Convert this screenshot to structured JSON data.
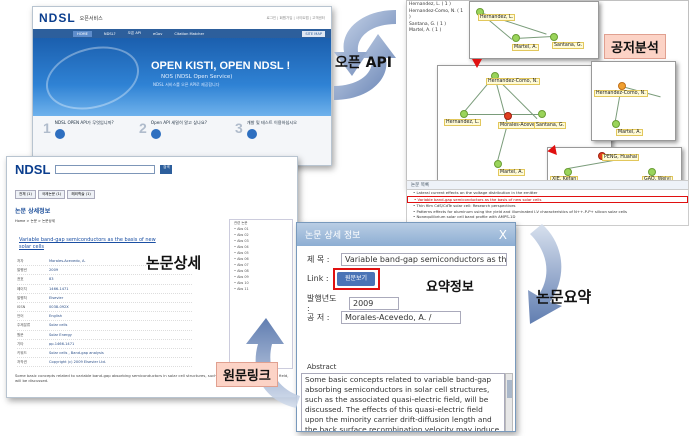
{
  "callouts": {
    "open_api": "오픈 API",
    "coauthor_analysis": "공저분석",
    "paper_detail": "논문상세",
    "paper_summary": "논문요약",
    "summary_info": "요약정보",
    "original_link": "원문링크"
  },
  "shot1": {
    "logo": "NDSL",
    "service": "오픈서비스",
    "toplinks": "로그인 | 회원가입 | 사이트맵 | 고객센터",
    "nav": [
      "HOME",
      "NDSL?",
      "오픈 API",
      "eGov",
      "Citation Matcher"
    ],
    "nav_sitemap": "SITE MAP",
    "hero_title": "OPEN KISTI, OPEN NDSL !",
    "hero_sub": "NOS (NDSL Open Service)",
    "hero_desc": "NDSL 서비스를 오픈 API로 제공합니다",
    "cards": [
      {
        "num": "1",
        "text": "NDSL OPEN API가 무엇입니까?"
      },
      {
        "num": "2",
        "text": "Open API 세밀히 알고 싶나요?"
      },
      {
        "num": "3",
        "text": "개발 및 테스트 이용하십시오"
      }
    ]
  },
  "shot2": {
    "authors": [
      "Hernandez, L. ( 1 )",
      "Hernandez-Como, N. ( 1 )",
      "Santana, G. ( 1 )",
      "Martel, A. ( 1 )"
    ],
    "nodes": {
      "hernandez": "Hernandez, L.",
      "martel": "Martel, A.",
      "santana": "Santana, G.",
      "hcomo": "Hernandez-Como, N.",
      "morales": "Morales-Acevedo",
      "pfeng": "PENG, Huahai",
      "xie": "XIE, Kefan",
      "gao": "GAO, Weiyi"
    },
    "footer": "논문 목록"
  },
  "midpanel": {
    "header": "논문 목록",
    "lines": [
      "• Lateral current effects on the voltage distribution in the emitter",
      "• Variable band-gap semiconductors as the basis of new solar cells",
      "• Thin film CdS/CdTe solar cell: Research perspectives",
      "• Patterns effects for aluminum using the yield and illuminated I-V characteristics of N++-P-P+ silicon solar cells",
      "• Nonequilibrium solar cell band profile with AMPS-1D"
    ]
  },
  "shot3": {
    "logo": "NDSL",
    "search_btn": "검색",
    "tabs": [
      "전체 (1)",
      "국제논문 (1)",
      "해외학술 (1)"
    ],
    "page_title": "논문 상세정보",
    "crumb": "Home > 논문 > 논문상세",
    "title": "Variable band-gap semiconductors as the basis of new solar cells",
    "rows": [
      {
        "k": "저자",
        "v": "Morales-Acevedo, A."
      },
      {
        "k": "발행년",
        "v": "2009"
      },
      {
        "k": "권호",
        "v": "83"
      },
      {
        "k": "페이지",
        "v": "1466-1471"
      },
      {
        "k": "발행처",
        "v": "Elsevier"
      },
      {
        "k": "ISSN",
        "v": "0038-092X"
      },
      {
        "k": "언어",
        "v": "English"
      },
      {
        "k": "주제분류",
        "v": "Solar cells"
      },
      {
        "k": "원문",
        "v": "Solar Energy"
      },
      {
        "k": "기타",
        "v": "pp.1466-1471"
      },
      {
        "k": "키워드",
        "v": "Solar cells , Band-gap analysis"
      },
      {
        "k": "저작권",
        "v": "Copyright (c) 2009 Elsevier Ltd."
      }
    ],
    "side": [
      "관련 논문",
      "• Abs 01",
      "• Abs 02",
      "• Abs 03",
      "• Abs 04",
      "• Abs 05",
      "• Abs 06",
      "• Abs 07",
      "• Abs 08",
      "• Abs 09",
      "• Abs 10",
      "• Abs 11"
    ],
    "abstract": "Some basic concepts related to variable band-gap absorbing semiconductors in solar cell structures, such as the associated quasi-electric field, will be discussed."
  },
  "shot4": {
    "title": "논문 상세 정보",
    "close": "X",
    "label_title": "제 목 :",
    "value_title": "Variable band-gap semiconductors as the basis of",
    "label_link": "Link :",
    "link_btn": "원문보기",
    "label_year": "발행년도 :",
    "value_year": "2009",
    "label_author": "공 저 :",
    "value_author": "Morales-Acevedo, A. /",
    "abstract_label": "Abstract",
    "abstract": "Some basic concepts related to variable band-gap absorbing semiconductors in solar cell structures, such as the associated quasi-electric field, will be discussed. The effects of this quasi-electric field upon the minority carrier drift-diffusion length and the back surface recombination velocity may induce a larger generated carrier collection at the junction with the corresponding"
  },
  "colors": {
    "accent_blue": "#2d5f9c",
    "callout_bg": "#fcd3c6",
    "highlight_red": "#e01010",
    "arrow_blue": "#4f6fa8"
  }
}
